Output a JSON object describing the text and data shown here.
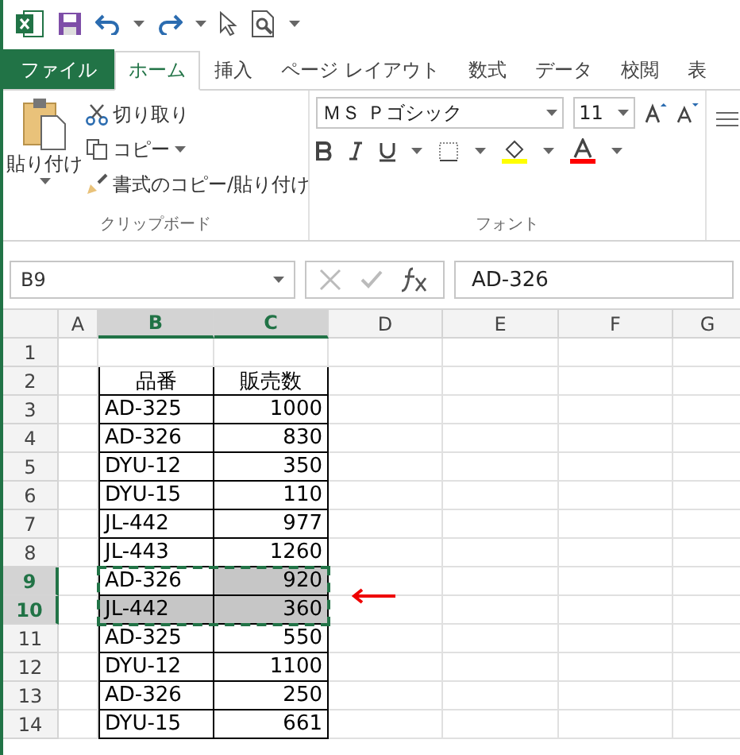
{
  "tabs": [
    {
      "label": "ファイル",
      "kind": "file",
      "selected": false
    },
    {
      "label": "ホーム",
      "kind": "tab",
      "selected": true
    },
    {
      "label": "挿入",
      "kind": "tab",
      "selected": false
    },
    {
      "label": "ページ レイアウト",
      "kind": "tab",
      "selected": false
    },
    {
      "label": "数式",
      "kind": "tab",
      "selected": false
    },
    {
      "label": "データ",
      "kind": "tab",
      "selected": false
    },
    {
      "label": "校閲",
      "kind": "tab",
      "selected": false
    },
    {
      "label": "表",
      "kind": "tab",
      "selected": false
    }
  ],
  "clipboard": {
    "paste": "貼り付け",
    "cut": "切り取り",
    "copy": "コピー",
    "format_painter": "書式のコピー/貼り付け",
    "group_label": "クリップボード"
  },
  "font": {
    "font_name": "ＭＳ Ｐゴシック",
    "font_size": "11",
    "group_label": "フォント"
  },
  "formula_bar": {
    "name_box": "B9",
    "formula": "AD-326"
  },
  "columns": [
    {
      "label": "A",
      "selected": false
    },
    {
      "label": "B",
      "selected": true
    },
    {
      "label": "C",
      "selected": true
    },
    {
      "label": "D",
      "selected": false
    },
    {
      "label": "E",
      "selected": false
    },
    {
      "label": "F",
      "selected": false
    },
    {
      "label": "G",
      "selected": false
    }
  ],
  "copy_marquee": true,
  "rows": [
    {
      "number": "1",
      "selected": false,
      "cells": []
    },
    {
      "number": "2",
      "selected": false,
      "cells": [
        {
          "text": "品番",
          "highlighted": false
        },
        {
          "text": "販売数",
          "highlighted": false
        }
      ]
    },
    {
      "number": "3",
      "selected": false,
      "cells": [
        {
          "text": "AD-325",
          "highlighted": false
        },
        {
          "text": "1000",
          "highlighted": false
        }
      ]
    },
    {
      "number": "4",
      "selected": false,
      "cells": [
        {
          "text": "AD-326",
          "highlighted": false
        },
        {
          "text": "830",
          "highlighted": false
        }
      ]
    },
    {
      "number": "5",
      "selected": false,
      "cells": [
        {
          "text": "DYU-12",
          "highlighted": false
        },
        {
          "text": "350",
          "highlighted": false
        }
      ]
    },
    {
      "number": "6",
      "selected": false,
      "cells": [
        {
          "text": "DYU-15",
          "highlighted": false
        },
        {
          "text": "110",
          "highlighted": false
        }
      ]
    },
    {
      "number": "7",
      "selected": false,
      "cells": [
        {
          "text": "JL-442",
          "highlighted": false
        },
        {
          "text": "977",
          "highlighted": false
        }
      ]
    },
    {
      "number": "8",
      "selected": false,
      "cells": [
        {
          "text": "JL-443",
          "highlighted": false
        },
        {
          "text": "1260",
          "highlighted": false
        }
      ]
    },
    {
      "number": "9",
      "selected": true,
      "cells": [
        {
          "text": "AD-326",
          "highlighted": false
        },
        {
          "text": "920",
          "highlighted": true
        }
      ]
    },
    {
      "number": "10",
      "selected": true,
      "cells": [
        {
          "text": "JL-442",
          "highlighted": true
        },
        {
          "text": "360",
          "highlighted": true
        }
      ]
    },
    {
      "number": "11",
      "selected": false,
      "cells": [
        {
          "text": "AD-325",
          "highlighted": false
        },
        {
          "text": "550",
          "highlighted": false
        }
      ]
    },
    {
      "number": "12",
      "selected": false,
      "cells": [
        {
          "text": "DYU-12",
          "highlighted": false
        },
        {
          "text": "1100",
          "highlighted": false
        }
      ]
    },
    {
      "number": "13",
      "selected": false,
      "cells": [
        {
          "text": "AD-326",
          "highlighted": false
        },
        {
          "text": "250",
          "highlighted": false
        }
      ]
    },
    {
      "number": "14",
      "selected": false,
      "cells": [
        {
          "text": "DYU-15",
          "highlighted": false
        },
        {
          "text": "661",
          "highlighted": false
        }
      ]
    }
  ]
}
